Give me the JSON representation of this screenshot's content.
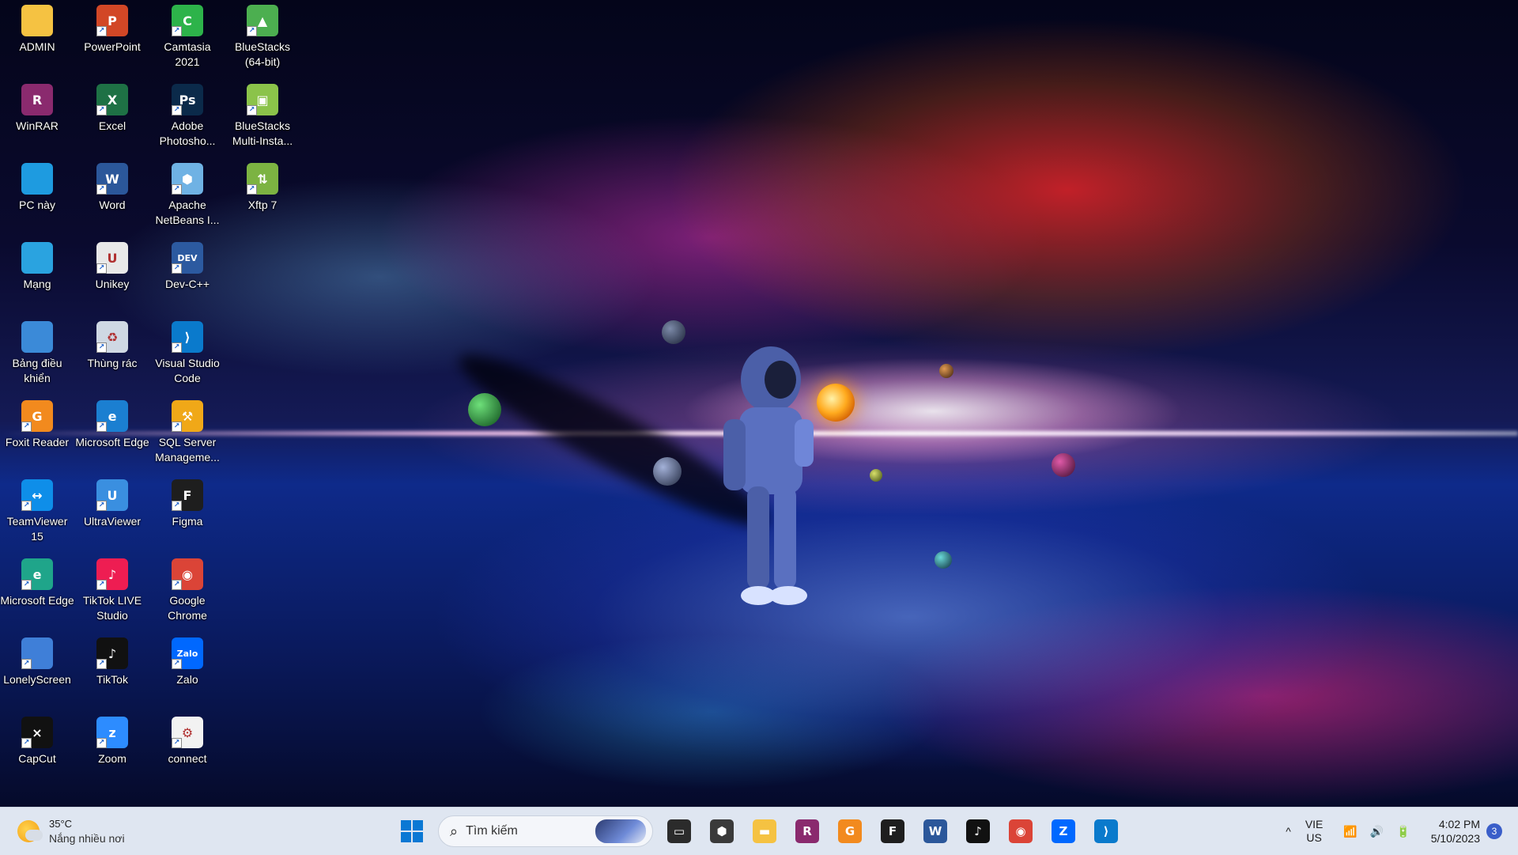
{
  "desktop": {
    "icons": [
      {
        "label": "ADMIN",
        "icon": "folder-icon",
        "color": "#f5c242",
        "glyph": ""
      },
      {
        "label": "WinRAR",
        "icon": "winrar-icon",
        "color": "#8a2a6e",
        "glyph": "R"
      },
      {
        "label": "PC này",
        "icon": "pc-icon",
        "color": "#1e9be0",
        "glyph": ""
      },
      {
        "label": "Mạng",
        "icon": "network-icon",
        "color": "#2aa3e0",
        "glyph": ""
      },
      {
        "label": "Bảng điều khiển",
        "icon": "control-panel-icon",
        "color": "#3b8ad8",
        "glyph": ""
      },
      {
        "label": "Foxit Reader",
        "icon": "foxit-reader-icon",
        "color": "#f28a1e",
        "glyph": "G"
      },
      {
        "label": "TeamViewer 15",
        "icon": "teamviewer-icon",
        "color": "#0e8ee9",
        "glyph": "↔"
      },
      {
        "label": "Microsoft Edge",
        "icon": "edge-icon",
        "color": "#1fa58a",
        "glyph": "e"
      },
      {
        "label": "LonelyScreen",
        "icon": "lonelyscreen-icon",
        "color": "#3f7fd8",
        "glyph": ""
      },
      {
        "label": "CapCut",
        "icon": "capcut-icon",
        "color": "#111111",
        "glyph": "⨯"
      },
      {
        "label": "PowerPoint",
        "icon": "powerpoint-icon",
        "color": "#d24726",
        "glyph": "P"
      },
      {
        "label": "Excel",
        "icon": "excel-icon",
        "color": "#1e7145",
        "glyph": "X"
      },
      {
        "label": "Word",
        "icon": "word-icon",
        "color": "#2b579a",
        "glyph": "W"
      },
      {
        "label": "Unikey",
        "icon": "unikey-icon",
        "color": "#e8e8e8",
        "glyph": "U"
      },
      {
        "label": "Thùng rác",
        "icon": "recycle-bin-icon",
        "color": "#cfd8e3",
        "glyph": "♻"
      },
      {
        "label": "Microsoft Edge",
        "icon": "edge-icon",
        "color": "#1b7fd1",
        "glyph": "e"
      },
      {
        "label": "UltraViewer",
        "icon": "ultraviewer-icon",
        "color": "#3a8fe0",
        "glyph": "U"
      },
      {
        "label": "TikTok LIVE Studio",
        "icon": "tiktok-live-studio-icon",
        "color": "#ee1d52",
        "glyph": "♪"
      },
      {
        "label": "TikTok",
        "icon": "tiktok-icon",
        "color": "#111111",
        "glyph": "♪"
      },
      {
        "label": "Zoom",
        "icon": "zoom-icon",
        "color": "#2d8cff",
        "glyph": "z"
      },
      {
        "label": "Camtasia 2021",
        "icon": "camtasia-icon",
        "color": "#2db34a",
        "glyph": "C"
      },
      {
        "label": "Adobe Photosho...",
        "icon": "photoshop-icon",
        "color": "#0b2a4a",
        "glyph": "Ps"
      },
      {
        "label": "Apache NetBeans I...",
        "icon": "netbeans-icon",
        "color": "#6fb2e4",
        "glyph": "⬢"
      },
      {
        "label": "Dev-C++",
        "icon": "devcpp-icon",
        "color": "#2c5aa0",
        "glyph": "DEV"
      },
      {
        "label": "Visual Studio Code",
        "icon": "vscode-icon",
        "color": "#0a7acc",
        "glyph": "⟩"
      },
      {
        "label": "SQL Server Manageme...",
        "icon": "sql-server-icon",
        "color": "#f0a818",
        "glyph": "⚒"
      },
      {
        "label": "Figma",
        "icon": "figma-icon",
        "color": "#1e1e1e",
        "glyph": "F"
      },
      {
        "label": "Google Chrome",
        "icon": "chrome-icon",
        "color": "#db4437",
        "glyph": "◉"
      },
      {
        "label": "Zalo",
        "icon": "zalo-icon",
        "color": "#0068ff",
        "glyph": "Zalo"
      },
      {
        "label": "connect",
        "icon": "connect-file-icon",
        "color": "#f2f2f2",
        "glyph": "⚙"
      },
      {
        "label": "BlueStacks (64-bit)",
        "icon": "bluestacks-icon",
        "color": "#4caf50",
        "glyph": "▲"
      },
      {
        "label": "BlueStacks Multi-Insta...",
        "icon": "bluestacks-multi-instance-icon",
        "color": "#8bc34a",
        "glyph": "▣"
      },
      {
        "label": "Xftp 7",
        "icon": "xftp-icon",
        "color": "#7cb342",
        "glyph": "⇅"
      }
    ]
  },
  "taskbar": {
    "weather": {
      "temp": "35°C",
      "desc": "Nắng nhiều nơi"
    },
    "search_placeholder": "Tìm kiếm",
    "apps": [
      {
        "name": "task-view",
        "color": "#2b2b2b",
        "glyph": "▭"
      },
      {
        "name": "unity-hub",
        "color": "#3a3a3a",
        "glyph": "⬢"
      },
      {
        "name": "file-explorer",
        "color": "#f5c242",
        "glyph": "▬"
      },
      {
        "name": "winrar",
        "color": "#8a2a6e",
        "glyph": "R"
      },
      {
        "name": "foxit-reader",
        "color": "#f28a1e",
        "glyph": "G"
      },
      {
        "name": "figma",
        "color": "#1e1e1e",
        "glyph": "F"
      },
      {
        "name": "word",
        "color": "#2b579a",
        "glyph": "W"
      },
      {
        "name": "tiktok",
        "color": "#111111",
        "glyph": "♪"
      },
      {
        "name": "chrome",
        "color": "#db4437",
        "glyph": "◉"
      },
      {
        "name": "zalo",
        "color": "#0068ff",
        "glyph": "Z"
      },
      {
        "name": "vscode",
        "color": "#0a7acc",
        "glyph": "⟩"
      }
    ],
    "tray": {
      "chevron": "^",
      "lang_top": "VIE",
      "lang_bottom": "US",
      "wifi": "📶",
      "volume": "🔊",
      "battery": "🔋",
      "time": "4:02 PM",
      "date": "5/10/2023",
      "notifications": "3"
    }
  }
}
